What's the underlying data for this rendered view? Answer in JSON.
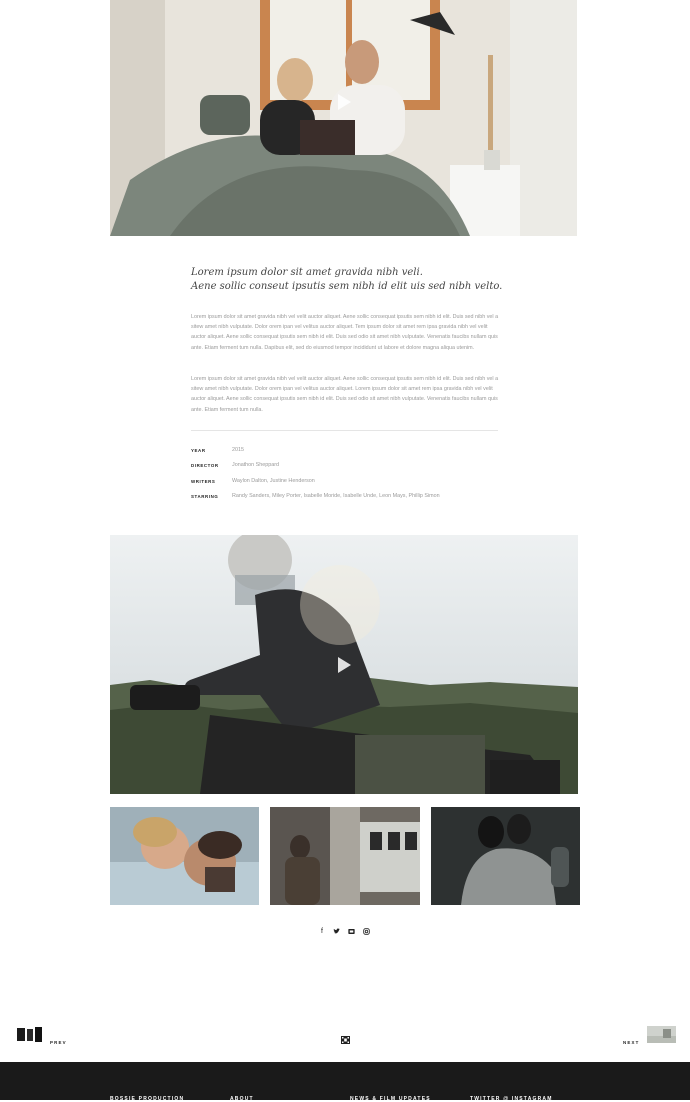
{
  "media": {
    "hero_image": "couple reading a book in bed",
    "video_image": "motorcyclist riding past forest",
    "gallery": [
      "couple embracing",
      "person in subway station",
      "couple hugging"
    ]
  },
  "article": {
    "lead_lines": [
      "Lorem ipsum dolor sit amet gravida nibh veli.",
      "Aene sollic conseut ipsutis sem nibh id elit uis sed nibh velto."
    ],
    "paragraphs": [
      "Lorem ipsum dolor sit amet gravida nibh vel velit auctor aliquet. Aene sollic consequat ipsutis sem nibh id elit. Duis sed nibh vel a sitew amet nibh vulputate. Dolor orem ipan vel velitus auctor aliquet. Tem ipsum dolor sit amet rem ipsa gravida nibh vel velit auctor aliquet. Aene sollic consequat ipsutis sem nibh id elit. Duis sed odio sit amet nibh vulputate. Venenatis faucibs nullam quis ante. Etiam ferment tum nulla. Dapibus elit, sed do eiusmod tempor incididunt ut labore et dolore magna aliqua utenim.",
      "Lorem ipsum dolor sit amet gravida nibh vel velit auctor aliquet. Aene sollic consequat ipsutis sem nibh id elit. Duis sed nibh vel a sitew amet nibh vulputate. Dolor orem ipan vel velitus auctor aliquet. Lorem ipsum dolor sit amet rem ipsa gravida nibh vel velit auctor aliquet. Aene sollic consequat ipsutis sem nibh id elit. Duis sed odio sit amet nibh vulputate. Venenatis faucibs nullam quis ante. Etiam ferment tum nulla."
    ]
  },
  "details": [
    {
      "label": "YEAR",
      "value": "2015"
    },
    {
      "label": "DIRECTOR",
      "value": "Jonathon Sheppard"
    },
    {
      "label": "WRITERS",
      "value": "Waylon Dalton, Justine Henderson"
    },
    {
      "label": "STARRING",
      "value": "Randy Sanders, Miley Porter, Isabelle Moride, Isabelle Unde, Leon Mays, Phillip Simon"
    }
  ],
  "social": [
    "facebook-icon",
    "twitter-icon",
    "vimeo-icon",
    "instagram-icon"
  ],
  "post_nav": {
    "prev_label": "PREV",
    "next_label": "NEXT",
    "grid_icon": "film-grid-icon"
  },
  "footer": {
    "headings": [
      "BOSSIE PRODUCTION",
      "ABOUT",
      "NEWS & FILM UPDATES",
      "TWITTER @ INSTAGRAM"
    ]
  }
}
